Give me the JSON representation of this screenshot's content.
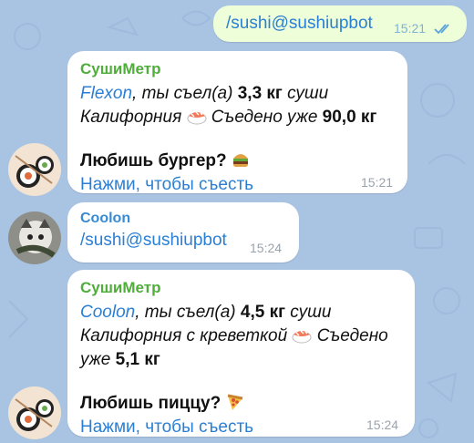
{
  "colors": {
    "background": "#a9c4e3",
    "bubble_in": "#ffffff",
    "bubble_out": "#eefed9",
    "bot_name": "#4fae3a",
    "user_name": "#3a8ad1",
    "link": "#2a7fd4"
  },
  "messages": [
    {
      "direction": "outgoing",
      "text": "/sushi@sushiupbot",
      "time": "15:21",
      "status": "read-double-check-icon"
    },
    {
      "direction": "incoming",
      "sender": "СушиМетр",
      "avatar": "sushi-bot-avatar",
      "line1_name": "Flexon",
      "line1_mid": ", ты съел(а) ",
      "line1_amount": "3,3 кг",
      "line1_tail": " суши",
      "line2_text": "Калифорния",
      "line2_mid": " Съедено уже ",
      "line2_total": "90,0 кг",
      "question": "Любишь бургер?",
      "question_icon": "burger-icon",
      "action": "Нажми, чтобы съесть",
      "time": "15:21"
    },
    {
      "direction": "incoming",
      "sender": "Coolon",
      "avatar": "cat-avatar",
      "text": "/sushi@sushiupbot",
      "time": "15:24"
    },
    {
      "direction": "incoming",
      "sender": "СушиМетр",
      "avatar": "sushi-bot-avatar",
      "line1_name": "Coolon",
      "line1_mid": ", ты съел(а) ",
      "line1_amount": "4,5 кг",
      "line1_tail": " суши",
      "line2_text": "Калифорния с креветкой",
      "line2_tail": " Съедено",
      "line3_prefix": "уже ",
      "line3_total": "5,1 кг",
      "question": "Любишь пиццу?",
      "question_icon": "pizza-icon",
      "action": "Нажми, чтобы съесть",
      "time": "15:24"
    }
  ]
}
